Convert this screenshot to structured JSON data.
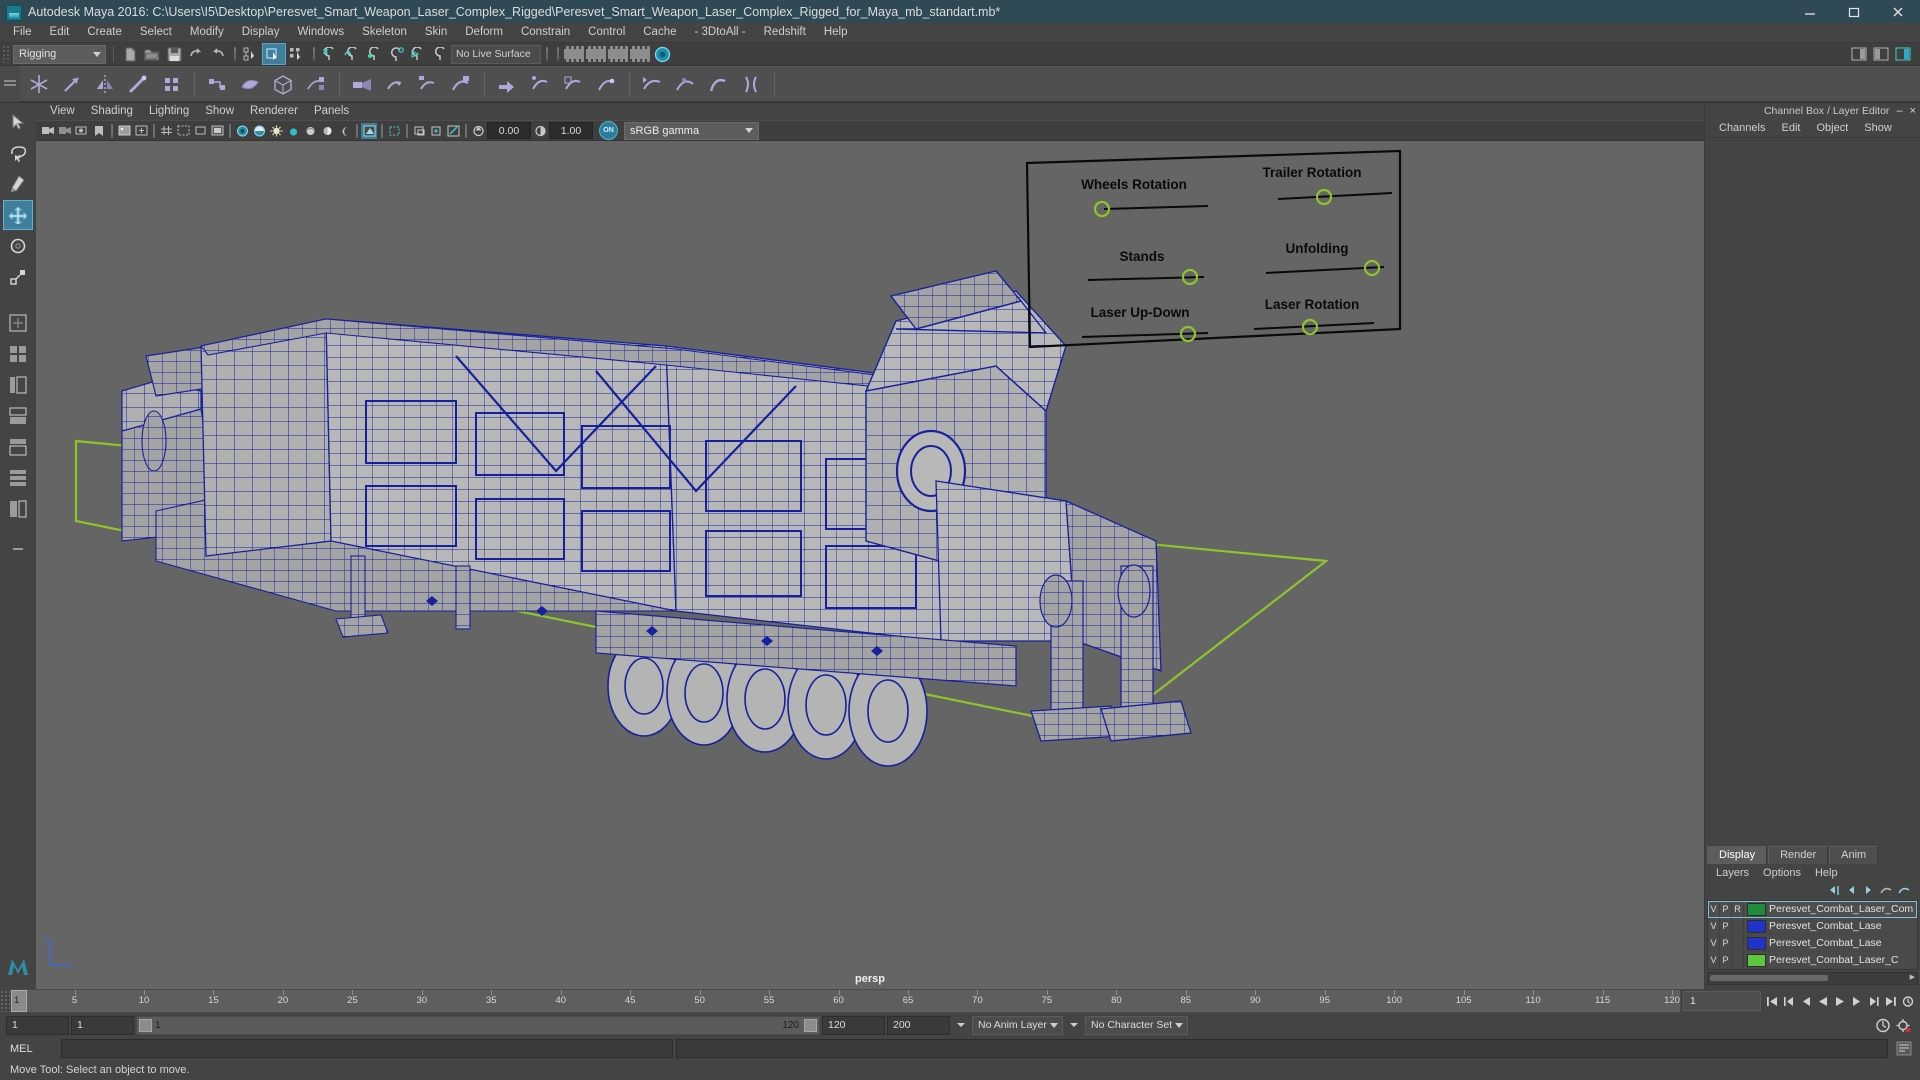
{
  "window": {
    "title": "Autodesk Maya 2016: C:\\Users\\I5\\Desktop\\Peresvet_Smart_Weapon_Laser_Complex_Rigged\\Peresvet_Smart_Weapon_Laser_Complex_Rigged_for_Maya_mb_standart.mb*",
    "minimize_label": "minimize",
    "maximize_label": "maximize",
    "close_label": "close",
    "app_icon": "maya-logo-icon"
  },
  "menubar": {
    "items": [
      "File",
      "Edit",
      "Create",
      "Select",
      "Modify",
      "Display",
      "Windows",
      "Skeleton",
      "Skin",
      "Deform",
      "Constrain",
      "Control",
      "Cache",
      "- 3DtoAll -",
      "Redshift",
      "Help"
    ]
  },
  "statusline": {
    "menu_set": "Rigging",
    "live_surface": "No Live Surface",
    "icons": [
      "new-scene-icon",
      "open-scene-icon",
      "save-scene-icon",
      "undo-icon",
      "redo-icon",
      "select-by-hierarchy-icon",
      "select-by-object-icon",
      "select-by-component-icon",
      "snap-to-grid-icon",
      "snap-to-curve-icon",
      "snap-to-point-icon",
      "snap-to-projected-center-icon",
      "snap-to-view-plane-icon",
      "make-live-icon",
      "show-render-view-icon",
      "render-current-frame-icon",
      "ipr-render-icon",
      "render-settings-icon",
      "hypershade-icon",
      "sidebar-attribute-editor-icon",
      "sidebar-tool-settings-icon",
      "sidebar-channel-box-icon"
    ]
  },
  "shelf": {
    "icons": [
      "create-joint-icon",
      "insert-joint-icon",
      "mirror-joint-icon",
      "ik-handle-icon",
      "ik-spline-handle-icon",
      "create-control-icon",
      "bind-skin-icon",
      "interactive-bind-icon",
      "detach-skin-icon",
      "paint-skin-weights-icon",
      "mirror-skin-weights-icon",
      "copy-skin-weights-icon",
      "smooth-skin-icon",
      "blend-shape-icon",
      "lattice-icon",
      "wrap-deformer-icon",
      "cluster-icon",
      "wire-deformer-icon",
      "soft-modification-icon",
      "nonlinear-bend-icon",
      "nonlinear-flare-icon"
    ]
  },
  "toolbox": {
    "tools": [
      {
        "name": "select-tool",
        "active": false
      },
      {
        "name": "lasso-select-tool",
        "active": false
      },
      {
        "name": "paint-select-tool",
        "active": false
      },
      {
        "name": "move-tool",
        "active": true
      },
      {
        "name": "rotate-tool",
        "active": false
      },
      {
        "name": "scale-tool",
        "active": false
      }
    ],
    "layouts": [
      "single-perspective-layout",
      "four-view-layout",
      "outliner-persp-layout",
      "persp-graph-layout",
      "hypershade-persp-layout",
      "persp-graph-hypergraph-layout",
      "two-pane-side-layout"
    ]
  },
  "viewport": {
    "panel_menus": [
      "View",
      "Shading",
      "Lighting",
      "Show",
      "Renderer",
      "Panels"
    ],
    "camera_label": "persp",
    "exposure_value": "0.00",
    "gamma_value": "1.00",
    "color_management_enabled_label": "ON",
    "color_management_transform": "sRGB gamma",
    "toolbar_icons": [
      "select-camera-icon",
      "lock-camera-icon",
      "camera-attributes-icon",
      "bookmark-icon",
      "image-plane-icon",
      "two-d-pan-zoom-icon",
      "grid-toggle-icon",
      "film-gate-icon",
      "resolution-gate-icon",
      "gate-mask-icon",
      "xray-toggle-icon",
      "xray-joints-icon",
      "wireframe-shading-icon",
      "smooth-shade-all-icon",
      "smooth-shade-textured-icon",
      "use-all-lights-icon",
      "shadows-icon",
      "screen-space-ao-icon",
      "motion-blur-icon",
      "multisample-aa-icon",
      "depth-of-field-icon",
      "isolate-select-icon",
      "x-ray-mode-icon",
      "default-material-icon",
      "texture-toggle-icon",
      "exposure-icon",
      "gamma-icon",
      "color-management-toggle-icon"
    ],
    "axis_gizmo": "axis-gizmo-xyz",
    "annotation_board": {
      "controls": [
        {
          "label": "Wheels Rotation"
        },
        {
          "label": "Trailer Rotation"
        },
        {
          "label": "Stands"
        },
        {
          "label": "Unfolding"
        },
        {
          "label": "Laser Up-Down"
        },
        {
          "label": "Laser Rotation"
        }
      ],
      "handle_color": "#8ec62a",
      "line_color": "#0a0a0a"
    },
    "colors": {
      "background": "#656565",
      "grid_plane": "#8ec62a",
      "wireframe": "#17219b",
      "surface": "#b4b4b4"
    }
  },
  "right_panel": {
    "title": "Channel Box / Layer Editor",
    "close_label": "×",
    "collapse_label": "–",
    "menus": [
      "Channels",
      "Edit",
      "Object",
      "Show"
    ],
    "tabs": [
      {
        "label": "Display",
        "active": true
      },
      {
        "label": "Render",
        "active": false
      },
      {
        "label": "Anim",
        "active": false
      }
    ],
    "layer_menus": [
      "Layers",
      "Options",
      "Help"
    ],
    "layer_tool_icons": [
      "new-layer-icon",
      "layer-prev-icon",
      "layer-next-icon",
      "layer-move-up-icon",
      "layer-move-down-icon"
    ],
    "layers": [
      {
        "visibility": "V",
        "playback": "P",
        "reference": "R",
        "color": "#1d8f3c",
        "name": "Peresvet_Combat_Laser_Com",
        "selected": true
      },
      {
        "visibility": "V",
        "playback": "P",
        "reference": "",
        "color": "#2233cc",
        "name": "Peresvet_Combat_Lase",
        "selected": false
      },
      {
        "visibility": "V",
        "playback": "P",
        "reference": "",
        "color": "#2233cc",
        "name": "Peresvet_Combat_Lase",
        "selected": false
      },
      {
        "visibility": "V",
        "playback": "P",
        "reference": "",
        "color": "#5ec640",
        "name": "Peresvet_Combat_Laser_C",
        "selected": false
      }
    ]
  },
  "time_slider": {
    "current_frame": "1",
    "start": 1,
    "end": 120,
    "ticks": [
      5,
      10,
      15,
      20,
      25,
      30,
      35,
      40,
      45,
      50,
      55,
      60,
      65,
      70,
      75,
      80,
      85,
      90,
      95,
      100,
      105,
      110,
      115,
      120
    ],
    "frame_field": "1",
    "playback_buttons": [
      "go-to-start-icon",
      "step-back-keyframe-icon",
      "step-back-frame-icon",
      "play-backwards-icon",
      "play-forwards-icon",
      "step-forward-frame-icon",
      "step-forward-keyframe-icon",
      "go-to-end-icon"
    ]
  },
  "range_slider": {
    "anim_start": "1",
    "range_start": "1",
    "range_bar_start": "1",
    "range_bar_end": "120",
    "range_end": "120",
    "anim_end": "200",
    "anim_layer": "No Anim Layer",
    "character_set": "No Character Set",
    "icons": [
      "auto-keyframe-icon",
      "animation-preferences-icon"
    ]
  },
  "command_line": {
    "language_label": "MEL",
    "input_value": "",
    "output_value": "",
    "buttons": [
      "script-editor-icon"
    ]
  },
  "help_line": {
    "message": "Move Tool: Select an object to move."
  }
}
